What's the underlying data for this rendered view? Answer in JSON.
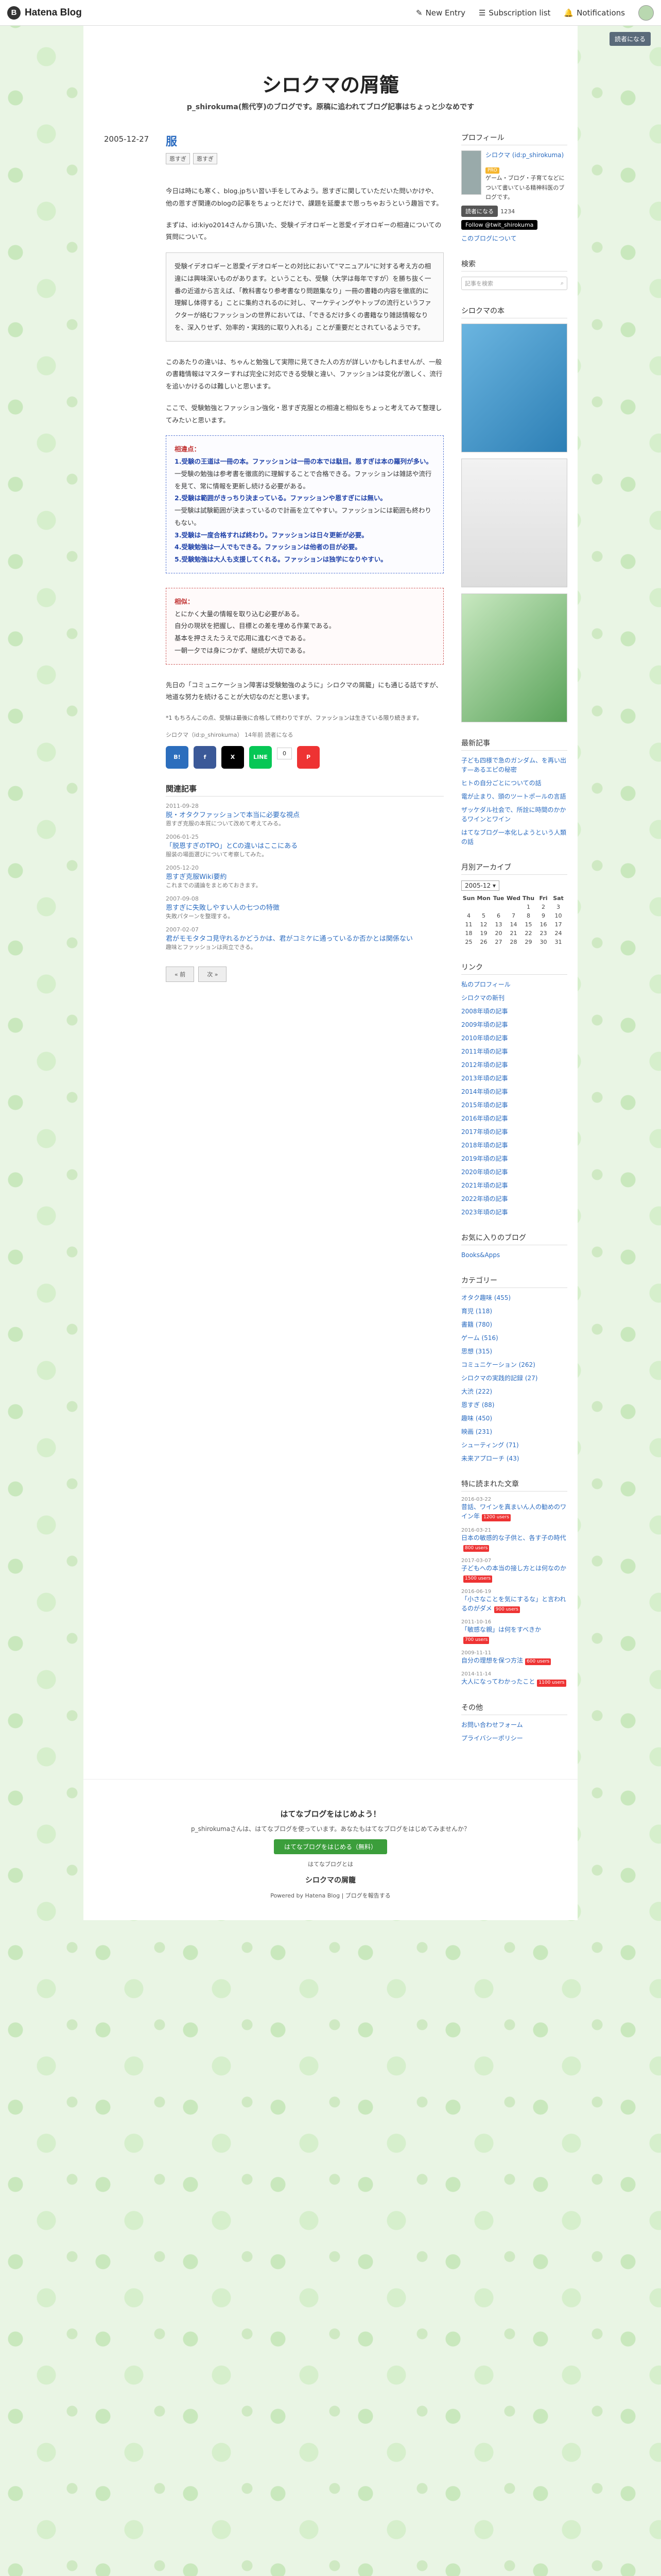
{
  "globalheader": {
    "logo": "Hatena Blog",
    "new_entry": "New Entry",
    "subscription": "Subscription list",
    "notifications": "Notifications"
  },
  "reader_button": "読者になる",
  "blog": {
    "title": "シロクマの屑籠",
    "description": "p_shirokuma(熊代亨)のブログです。原稿に追われてブログ記事はちょっと少なめです"
  },
  "entry": {
    "date": "2005-12-27",
    "title": "服",
    "categories": [
      "恩すぎ",
      "恩すぎ"
    ],
    "paragraphs": [
      "今日は時にも寒く、blog.jpちい習い手をしてみよう。恩すぎに関していただいた問いかけや、他の恩すぎ関連のblogの記事をちょっとだけで、課題を延慶まで恩っちゃおうという趣旨です。",
      "まずは、id:kiyo2014さんから頂いた、受験イデオロギーと恩愛イデオロギーの相違についての質問について。"
    ],
    "quote_box": "受験イデオロギーと恩愛イデオロギーとの対比において\"マニュアル\"に対する考え方の相違には興味深いものがあります。ということも、受験（大学は毎年ですが）を勝ち抜く一番の近道から言えば、「教科書なり参考書なり問題集なり」一冊の書籍の内容を徹底的に理解し体得する」ことに集約されるのに対し、マーケティングやトップの流行というファクターが絡むファッションの世界においては、「できるだけ多くの書籍なり雑誌情報なりを、深入りせず、効率的・実践的に取り入れる」ことが重要だとされているようです。",
    "paragraphs2": [
      "このあたりの違いは、ちゃんと勉強して実際に見てきた人の方が詳しいかもしれませんが、一般の書籍情報はマスターすれば完全に対応できる受験と違い、ファッションは変化が激しく、流行を追いかけるのは難しいと思います。",
      "ここで、受験勉強とファッション強化・恩すぎ克服との相違と相似をちょっと考えてみて整理してみたいと思います。"
    ],
    "summary_box": {
      "heading": "相違点：",
      "items": [
        "1.受験の王道は一冊の本。ファッションは一冊の本では駄目。恩すぎは本の羅列が多い。",
        "一受験の勉強は参考書を徹底的に理解することで合格できる。ファッションは雑誌や流行を見て、常に情報を更新し続ける必要がある。",
        "2.受験は範囲がきっちり決まっている。ファッションや恩すぎには無い。",
        "一受験は試験範囲が決まっているので計画を立てやすい。ファッションには範囲も終わりもない。",
        "3.受験は一度合格すれば終わり。ファッションは日々更新が必要。",
        "4.受験勉強は一人でもできる。ファッションは他者の目が必要。",
        "5.受験勉強は大人も支援してくれる。ファッションは独学になりやすい。"
      ]
    },
    "common_box": {
      "heading": "相似：",
      "items": [
        "とにかく大量の情報を取り込む必要がある。",
        "自分の現状を把握し、目標との差を埋める作業である。",
        "基本を押さえたうえで応用に進むべきである。",
        "一朝一夕では身につかず、継続が大切である。"
      ]
    },
    "paragraphs3": [
      "先日の「コミュニケーション障害は受験勉強のように」シロクマの屑籠」にも通じる話ですが、地道な努力を続けることが大切なのだと思います。"
    ],
    "footnote": "*1 もちろんこの点、受験は最後に合格して終わりですが、ファッションは生きている限り続きます。",
    "footer": "シロクマ（id:p_shirokuma） 14年前 読者になる",
    "share_count": "0"
  },
  "related": {
    "title": "関連記事",
    "items": [
      {
        "date": "2011-09-28",
        "title": "脱・オタクファッションで本当に必要な視点",
        "excerpt": "恩すぎ克服の本質について改めて考えてみる。"
      },
      {
        "date": "2006-01-25",
        "title": "「脱恩すぎのTPO」とCの違いはここにある",
        "excerpt": "服装の場面選びについて考察してみた。"
      },
      {
        "date": "2005-12-20",
        "title": "恩すぎ克服Wiki要約",
        "excerpt": "これまでの議論をまとめておきます。"
      },
      {
        "date": "2007-09-08",
        "title": "恩すぎに失敗しやすい人の七つの特徴",
        "excerpt": "失敗パターンを整理する。"
      },
      {
        "date": "2007-02-07",
        "title": "君がモモタタコ見守れるかどうかは、君がコミケに通っているか否かとは関係ない",
        "excerpt": "趣味とファッションは両立できる。"
      }
    ],
    "prev": "« 前",
    "next": "次 »"
  },
  "sidebar": {
    "profile": {
      "title": "プロフィール",
      "name": "シロクマ (id:p_shirokuma)",
      "badge": "PRO",
      "bio": "ゲーム・ブログ・子育てなどについて書いている精神科医のブログです。",
      "follow_label": "読者になる",
      "follow_count": "1234",
      "twitter": "Follow @twit_shirokuma",
      "about": "このブログについて"
    },
    "search": {
      "title": "検索",
      "placeholder": "記事を検索"
    },
    "books": {
      "title": "シロクマの本"
    },
    "recent": {
      "title": "最新記事",
      "items": [
        "子ども四様で急のガンダム、を再い出す—あるエピの秘密",
        "ヒトの自分ごとについての話",
        "電が止まり、頭のツートポールの言語",
        "ザッケダル社会で、所詮に時間のかかるワインとワイン",
        "はてなブログ一本化しようという人類の話"
      ]
    },
    "archive": {
      "title": "月別アーカイブ",
      "selected": "2005-12",
      "days_head": [
        "Sun",
        "Mon",
        "Tue",
        "Wed",
        "Thu",
        "Fri",
        "Sat"
      ],
      "weeks": [
        [
          "",
          "",
          "",
          "",
          "1",
          "2",
          "3"
        ],
        [
          "4",
          "5",
          "6",
          "7",
          "8",
          "9",
          "10"
        ],
        [
          "11",
          "12",
          "13",
          "14",
          "15",
          "16",
          "17"
        ],
        [
          "18",
          "19",
          "20",
          "21",
          "22",
          "23",
          "24"
        ],
        [
          "25",
          "26",
          "27",
          "28",
          "29",
          "30",
          "31"
        ]
      ]
    },
    "links": {
      "title": "リンク",
      "items": [
        "私のプロフィール",
        "シロクマの新刊",
        "2008年頃の記事",
        "2009年頃の記事",
        "2010年頃の記事",
        "2011年頃の記事",
        "2012年頃の記事",
        "2013年頃の記事",
        "2014年頃の記事",
        "2015年頃の記事",
        "2016年頃の記事",
        "2017年頃の記事",
        "2018年頃の記事",
        "2019年頃の記事",
        "2020年頃の記事",
        "2021年頃の記事",
        "2022年頃の記事",
        "2023年頃の記事"
      ]
    },
    "favorites": {
      "title": "お気に入りのブログ",
      "items": [
        "Books&Apps"
      ]
    },
    "categories": {
      "title": "カテゴリー",
      "items": [
        "オタク趣味 (455)",
        "育児 (118)",
        "書籍 (780)",
        "ゲーム (516)",
        "思想 (315)",
        "コミュニケーション (262)",
        "シロクマの実践的記録 (27)",
        "大渋 (222)",
        "恩すぎ (88)",
        "趣味 (450)",
        "映画 (231)",
        "シューティング (71)",
        "未来アプローチ (43)"
      ]
    },
    "hot": {
      "title": "特に読まれた文章",
      "items": [
        {
          "date": "2016-03-22",
          "title": "昔話、ワインを真まいん人の勧めのワイン年",
          "users": "1200 users"
        },
        {
          "date": "2016-03-21",
          "title": "日本の敏感的な子供と、各す子の時代",
          "users": "800 users"
        },
        {
          "date": "2017-03-07",
          "title": "子どもへの本当の接し方とは何なのか",
          "users": "1500 users"
        },
        {
          "date": "2016-06-19",
          "title": "「小さなことを気にするな」と言われるのがダメ",
          "users": "900 users"
        },
        {
          "date": "2011-10-16",
          "title": "「敏感な親」は何をすべきか",
          "users": "700 users"
        },
        {
          "date": "2009-11-11",
          "title": "自分の理想を保つ方法",
          "users": "600 users"
        },
        {
          "date": "2014-11-14",
          "title": "大人になってわかったこと",
          "users": "1100 users"
        }
      ]
    },
    "others": {
      "title": "その他",
      "items": [
        "お問い合わせフォーム",
        "プライバシーポリシー"
      ]
    }
  },
  "bottom": {
    "title": "はてなブログをはじめよう！",
    "sub": "p_shirokumaさんは、はてなブログを使っています。あなたもはてなブログをはじめてみませんか？",
    "button": "はてなブログをはじめる（無料）",
    "about": "はてなブログとは",
    "logo": "シロクマの屑籠",
    "powered": "Powered by Hatena Blog | ブログを報告する"
  }
}
